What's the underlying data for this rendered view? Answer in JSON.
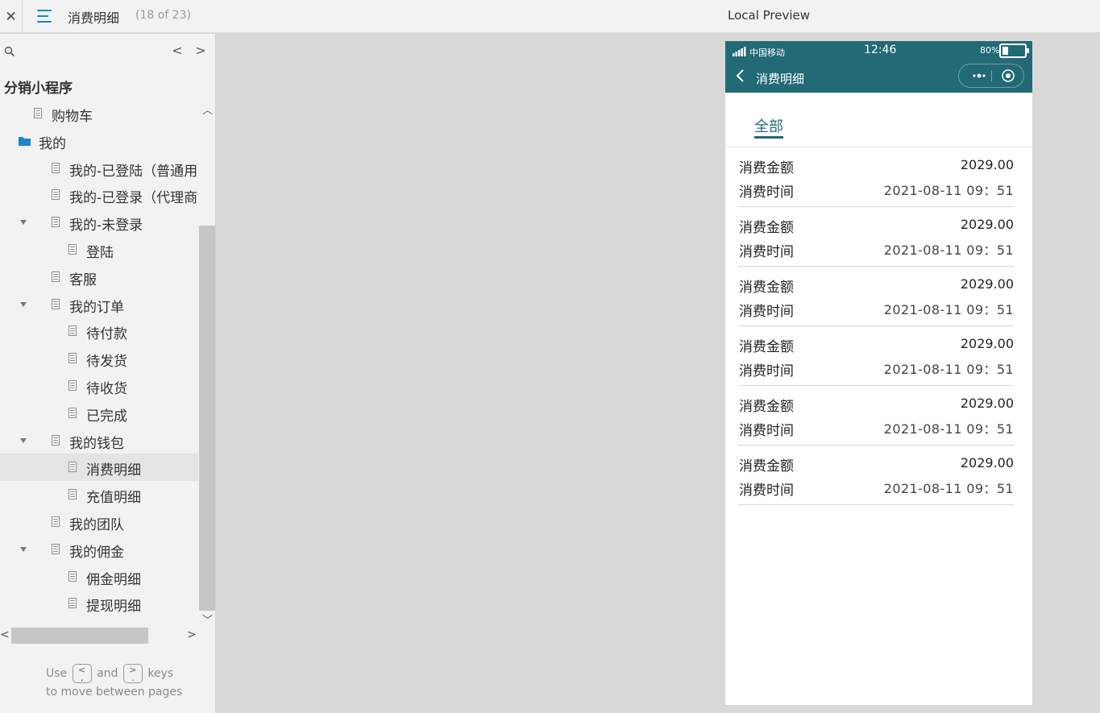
{
  "topbar": {
    "close_icon": "close-icon",
    "menu_icon": "hamburger-icon",
    "page_title": "消费明细",
    "page_count": "(18 of 23)",
    "preview_title": "Local Preview"
  },
  "sidebar": {
    "search_icon": "search-icon",
    "prev_glyph": "<",
    "next_glyph": ">",
    "project_title": "分销小程序",
    "tree": [
      {
        "label": "购物车",
        "level": 1,
        "type": "page"
      },
      {
        "label": "我的",
        "level": 0,
        "type": "folder",
        "expanded": true
      },
      {
        "label": "我的-已登陆（普通用户",
        "level": 2,
        "type": "page"
      },
      {
        "label": "我的-已登录（代理商用",
        "level": 2,
        "type": "page"
      },
      {
        "label": "我的-未登录",
        "level": 2,
        "type": "page",
        "expanded": true
      },
      {
        "label": "登陆",
        "level": 3,
        "type": "page"
      },
      {
        "label": "客服",
        "level": 2,
        "type": "page"
      },
      {
        "label": "我的订单",
        "level": 2,
        "type": "page",
        "expanded": true
      },
      {
        "label": "待付款",
        "level": 3,
        "type": "page"
      },
      {
        "label": "待发货",
        "level": 3,
        "type": "page"
      },
      {
        "label": "待收货",
        "level": 3,
        "type": "page"
      },
      {
        "label": "已完成",
        "level": 3,
        "type": "page"
      },
      {
        "label": "我的钱包",
        "level": 2,
        "type": "page",
        "expanded": true
      },
      {
        "label": "消费明细",
        "level": 3,
        "type": "page",
        "selected": true
      },
      {
        "label": "充值明细",
        "level": 3,
        "type": "page"
      },
      {
        "label": "我的团队",
        "level": 2,
        "type": "page"
      },
      {
        "label": "我的佣金",
        "level": 2,
        "type": "page",
        "expanded": true
      },
      {
        "label": "佣金明细",
        "level": 3,
        "type": "page"
      },
      {
        "label": "提现明细",
        "level": 3,
        "type": "page"
      }
    ],
    "hint": {
      "use": "Use",
      "key_prev": "<\n,",
      "and": "and",
      "key_next": ">\n.",
      "keys": "keys",
      "line2": "to move between pages"
    }
  },
  "phone": {
    "status": {
      "carrier": "中国移动",
      "time": "12:46",
      "battery": "80%",
      "battery_level": 0.8
    },
    "title": "消费明细",
    "back_icon": "chevron-left-icon",
    "more_icon": "more-dots-icon",
    "close_icon": "target-circle-icon",
    "tab_all": "全部",
    "records": [
      {
        "amount_label": "消费金额",
        "amount": "2029.00",
        "time_label": "消费时间",
        "time": "2021-08-11  09：51"
      },
      {
        "amount_label": "消费金额",
        "amount": "2029.00",
        "time_label": "消费时间",
        "time": "2021-08-11  09：51"
      },
      {
        "amount_label": "消费金额",
        "amount": "2029.00",
        "time_label": "消费时间",
        "time": "2021-08-11  09：51"
      },
      {
        "amount_label": "消费金额",
        "amount": "2029.00",
        "time_label": "消费时间",
        "time": "2021-08-11  09：51"
      },
      {
        "amount_label": "消费金额",
        "amount": "2029.00",
        "time_label": "消费时间",
        "time": "2021-08-11  09：51"
      },
      {
        "amount_label": "消费金额",
        "amount": "2029.00",
        "time_label": "消费时间",
        "time": "2021-08-11  09：51"
      }
    ]
  },
  "colors": {
    "accent_blue": "#1d86c8",
    "phone_header": "#226a75",
    "selected_row": "#e4e4e4"
  }
}
